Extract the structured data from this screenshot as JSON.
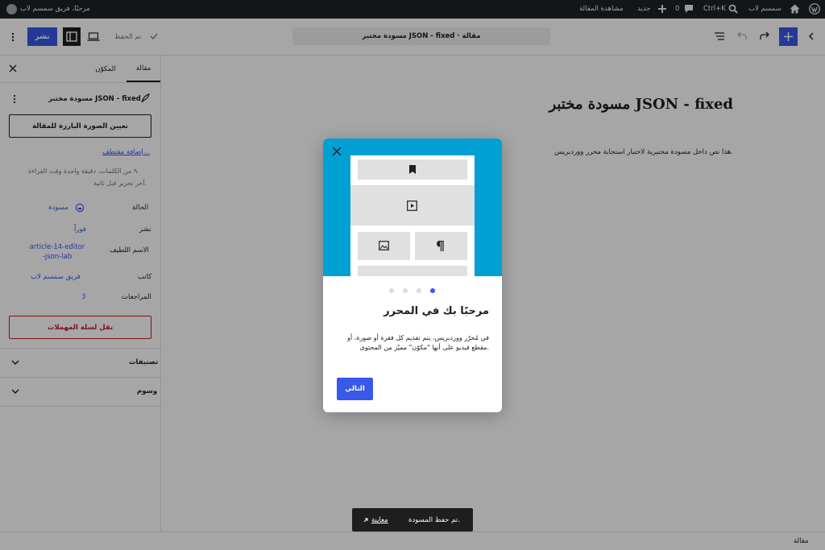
{
  "admin_bar": {
    "greeting": "مرحبًا، فريق سمسم لاب",
    "site_name": "سمسم لاب",
    "search_shortcut": "Ctrl+K",
    "comments_count": "0",
    "new_label": "جديد",
    "view_post": "مشاهدة المقالة"
  },
  "header": {
    "publish_label": "نشر",
    "saved_label": "تم الحفظ",
    "document_title": "مسودة مختبر JSON - fixed · مقالة"
  },
  "sidebar": {
    "tabs": [
      {
        "label": "مقالة"
      },
      {
        "label": "المكوّن"
      }
    ],
    "post_title": "مسودة مختبر JSON - fixed",
    "featured_image_button": "تعيين الصورة البارزة للمقالة",
    "add_excerpt": "إضافة مقتطف...",
    "stats_line1": "٩ من الكلمات، دقيقة واحدة وقت القراءة.",
    "stats_line2": "آخر تحرير قبل ثانية.",
    "rows": [
      {
        "label": "الحالة",
        "value": "مسودة"
      },
      {
        "label": "نشر",
        "value": "فوراً"
      },
      {
        "label": "الاسم اللطيف",
        "value": "article-14-editor-json-lab"
      },
      {
        "label": "كاتب",
        "value": "فريق سمسم لاب"
      },
      {
        "label": "المراجعات",
        "value": "3"
      }
    ],
    "trash_button": "نقل لسلة المهملات",
    "panels": [
      {
        "label": "تصنيفات"
      },
      {
        "label": "وسوم"
      }
    ]
  },
  "canvas": {
    "title": "مسودة مختبر JSON - fixed",
    "paragraph": "هذا نص داخل مسودة مختبرية لاختبار استجابة محرر ووردبريس."
  },
  "modal": {
    "heading": "مرحبًا بك في المحرر",
    "body": "في مُحرّر ووردبريس، يتم تقديم كل فقرة أو صورة، أو مقطع فيديو على أنها \"مكوّن\" مميّز من المحتوى.",
    "next_button": "التالي",
    "pages_total": 4,
    "current_page": 1
  },
  "snackbar": {
    "message": "تم حفظ المسودة.",
    "action": "معاينة"
  },
  "footer": {
    "breadcrumb": "مقالة"
  },
  "colors": {
    "accent": "#3858e9",
    "admin_bar": "#1d2327",
    "modal_illustration": "#00a0d2",
    "destructive": "#cc1818"
  }
}
